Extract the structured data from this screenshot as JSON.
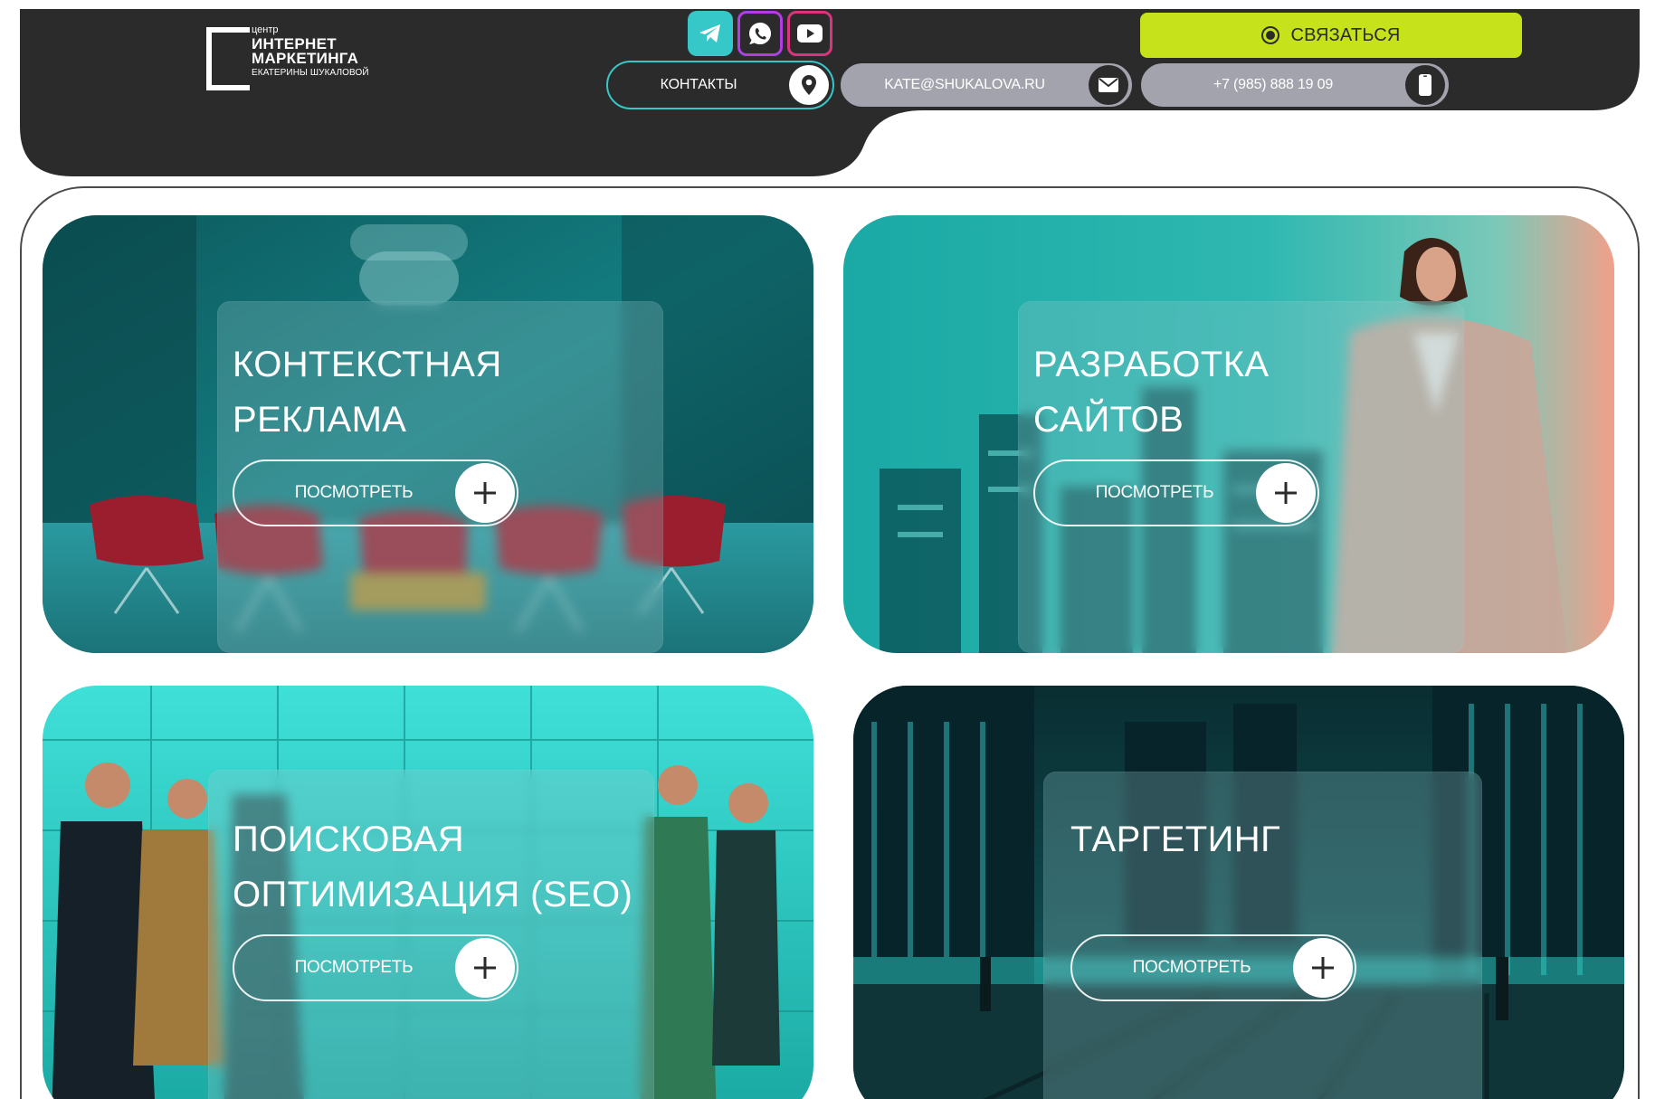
{
  "header": {
    "logo": {
      "small": "центр",
      "line1": "ИНТЕРНЕТ",
      "line2": "МАРКЕТИНГА",
      "sub": "ЕКАТЕРИНЫ ШУКАЛОВОЙ"
    },
    "social": [
      {
        "name": "telegram-icon",
        "color": "#36c7c8"
      },
      {
        "name": "whatsapp-icon",
        "color": "#b23ce6"
      },
      {
        "name": "youtube-icon",
        "color": "#d8357e"
      }
    ],
    "contacts_label": "КОНТАКТЫ",
    "email": "KATE@SHUKALOVA.RU",
    "phone": "+7 (985) 888 19 09",
    "cta_label": "СВЯЗАТЬСЯ",
    "colors": {
      "header_bg": "#2b2b2b",
      "accent_teal": "#36c7c8",
      "cta_green": "#c5e21a",
      "pill_gray": "#a3a3ae"
    }
  },
  "services": [
    {
      "title": "КОНТЕКСТНАЯ\nРЕКЛАМА",
      "button": "ПОСМОТРЕТЬ"
    },
    {
      "title": "РАЗРАБОТКА\nСАЙТОВ",
      "button": "ПОСМОТРЕТЬ"
    },
    {
      "title": "ПОИСКОВАЯ\nОПТИМИЗАЦИЯ (SEO)",
      "button": "ПОСМОТРЕТЬ"
    },
    {
      "title": "ТАРГЕТИНГ",
      "button": "ПОСМОТРЕТЬ"
    }
  ]
}
